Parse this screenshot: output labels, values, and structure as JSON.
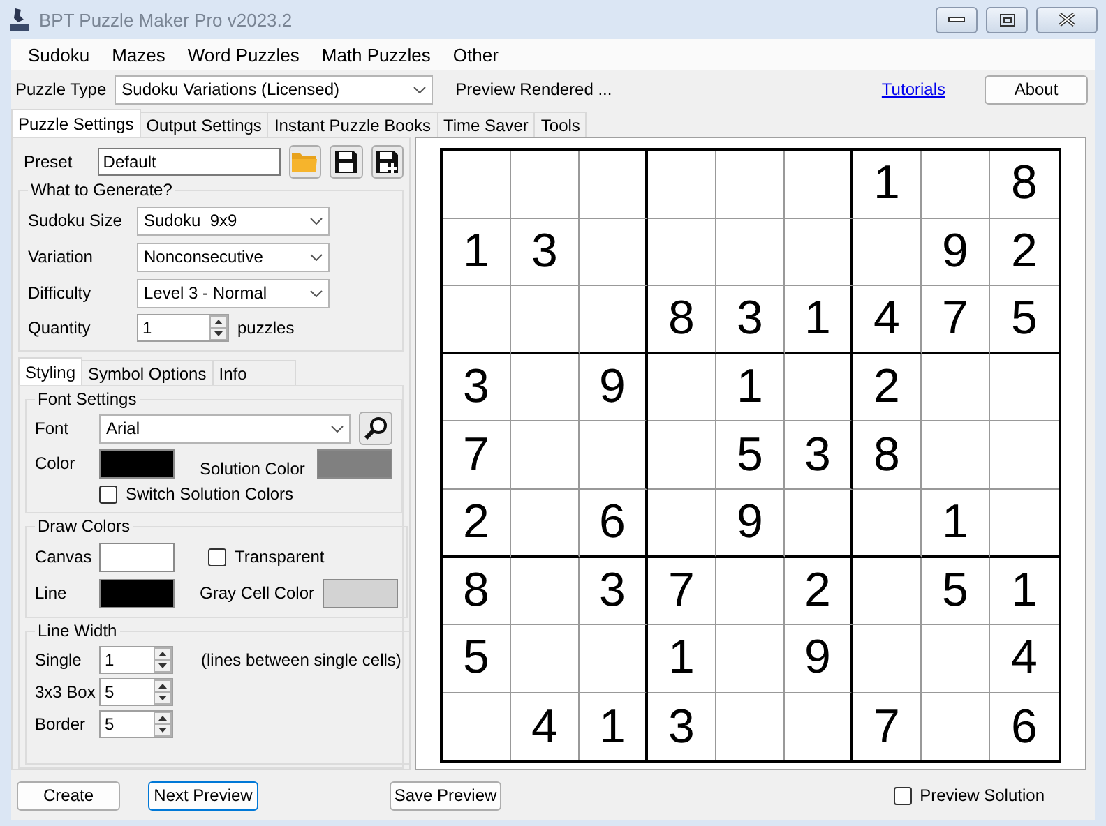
{
  "window": {
    "title": "BPT Puzzle Maker Pro v2023.2"
  },
  "menu": [
    "Sudoku",
    "Mazes",
    "Word Puzzles",
    "Math Puzzles",
    "Other"
  ],
  "toolbar": {
    "puzzle_type_label": "Puzzle Type",
    "puzzle_type": "Sudoku Variations (Licensed)",
    "status": "Preview Rendered ...",
    "tutorials_link": "Tutorials",
    "about_button": "About"
  },
  "tabs": [
    {
      "label": "Puzzle Settings",
      "selected": true
    },
    {
      "label": "Output Settings",
      "selected": false
    },
    {
      "label": "Instant Puzzle Books",
      "selected": false
    },
    {
      "label": "Time Saver",
      "selected": false
    },
    {
      "label": "Tools",
      "selected": false
    }
  ],
  "preset": {
    "label": "Preset",
    "value": "Default"
  },
  "generate": {
    "title": "What to Generate?",
    "fields": [
      {
        "label": "Sudoku Size",
        "value": "Sudoku  9x9"
      },
      {
        "label": "Variation",
        "value": "Nonconsecutive"
      },
      {
        "label": "Difficulty",
        "value": "Level 3 - Normal"
      }
    ],
    "quantity": {
      "label": "Quantity",
      "value": "1",
      "unit": "puzzles"
    }
  },
  "subtabs": [
    {
      "label": "Styling",
      "selected": true
    },
    {
      "label": "Symbol Options",
      "selected": false
    },
    {
      "label": "Info",
      "selected": false
    }
  ],
  "font_settings": {
    "title": "Font Settings",
    "font_label": "Font",
    "font": "Arial",
    "font_color": {
      "label": "Color",
      "color": "#000000"
    },
    "solution_color": {
      "label": "Solution Color",
      "color": "#808080"
    },
    "switch_colors": {
      "label": "Switch Solution Colors",
      "checked": false
    }
  },
  "draw_colors": {
    "title": "Draw Colors",
    "canvas": {
      "label": "Canvas",
      "color": "#ffffff"
    },
    "transparent": {
      "label": "Transparent",
      "checked": false
    },
    "line": {
      "label": "Line",
      "color": "#000000"
    },
    "gray_cell": {
      "label": "Gray Cell Color",
      "color": "#d3d3d3"
    }
  },
  "line_width": {
    "title": "Line Width",
    "rows": [
      {
        "label": "Single",
        "value": "1",
        "note": "(lines between single cells)"
      },
      {
        "label": "3x3 Box",
        "value": "5"
      },
      {
        "label": "Border",
        "value": "5"
      }
    ]
  },
  "grid": [
    [
      {
        "kind": "blank"
      },
      {
        "kind": "blank"
      },
      {
        "kind": "blank"
      },
      {
        "kind": "blank"
      },
      {
        "kind": "blank"
      },
      {
        "kind": "blank"
      },
      {
        "kind": "given",
        "value": "1"
      },
      {
        "kind": "blank"
      },
      {
        "kind": "given",
        "value": "8"
      }
    ],
    [
      {
        "kind": "given",
        "value": "1"
      },
      {
        "kind": "given",
        "value": "3"
      },
      {
        "kind": "blank"
      },
      {
        "kind": "blank"
      },
      {
        "kind": "blank"
      },
      {
        "kind": "blank"
      },
      {
        "kind": "blank"
      },
      {
        "kind": "given",
        "value": "9"
      },
      {
        "kind": "given",
        "value": "2"
      }
    ],
    [
      {
        "kind": "blank"
      },
      {
        "kind": "blank"
      },
      {
        "kind": "blank"
      },
      {
        "kind": "given",
        "value": "8"
      },
      {
        "kind": "given",
        "value": "3"
      },
      {
        "kind": "given",
        "value": "1"
      },
      {
        "kind": "given",
        "value": "4"
      },
      {
        "kind": "given",
        "value": "7"
      },
      {
        "kind": "given",
        "value": "5"
      }
    ],
    [
      {
        "kind": "given",
        "value": "3"
      },
      {
        "kind": "blank"
      },
      {
        "kind": "given",
        "value": "9"
      },
      {
        "kind": "blank"
      },
      {
        "kind": "given",
        "value": "1"
      },
      {
        "kind": "blank"
      },
      {
        "kind": "given",
        "value": "2"
      },
      {
        "kind": "blank"
      },
      {
        "kind": "blank"
      }
    ],
    [
      {
        "kind": "given",
        "value": "7"
      },
      {
        "kind": "blank"
      },
      {
        "kind": "blank"
      },
      {
        "kind": "blank"
      },
      {
        "kind": "given",
        "value": "5"
      },
      {
        "kind": "given",
        "value": "3"
      },
      {
        "kind": "given",
        "value": "8"
      },
      {
        "kind": "blank"
      },
      {
        "kind": "blank"
      }
    ],
    [
      {
        "kind": "given",
        "value": "2"
      },
      {
        "kind": "blank"
      },
      {
        "kind": "given",
        "value": "6"
      },
      {
        "kind": "blank"
      },
      {
        "kind": "given",
        "value": "9"
      },
      {
        "kind": "blank"
      },
      {
        "kind": "blank"
      },
      {
        "kind": "given",
        "value": "1"
      },
      {
        "kind": "blank"
      }
    ],
    [
      {
        "kind": "given",
        "value": "8"
      },
      {
        "kind": "blank"
      },
      {
        "kind": "given",
        "value": "3"
      },
      {
        "kind": "given",
        "value": "7"
      },
      {
        "kind": "blank"
      },
      {
        "kind": "given",
        "value": "2"
      },
      {
        "kind": "blank"
      },
      {
        "kind": "given",
        "value": "5"
      },
      {
        "kind": "given",
        "value": "1"
      }
    ],
    [
      {
        "kind": "given",
        "value": "5"
      },
      {
        "kind": "blank"
      },
      {
        "kind": "blank"
      },
      {
        "kind": "given",
        "value": "1"
      },
      {
        "kind": "blank"
      },
      {
        "kind": "given",
        "value": "9"
      },
      {
        "kind": "blank"
      },
      {
        "kind": "blank"
      },
      {
        "kind": "given",
        "value": "4"
      }
    ],
    [
      {
        "kind": "blank"
      },
      {
        "kind": "given",
        "value": "4"
      },
      {
        "kind": "given",
        "value": "1"
      },
      {
        "kind": "given",
        "value": "3"
      },
      {
        "kind": "blank"
      },
      {
        "kind": "blank"
      },
      {
        "kind": "given",
        "value": "7"
      },
      {
        "kind": "blank"
      },
      {
        "kind": "given",
        "value": "6"
      }
    ]
  ],
  "bottom": {
    "create": "Create",
    "next_preview": "Next Preview",
    "save_preview": "Save Preview",
    "preview_solution": {
      "label": "Preview Solution",
      "checked": false
    }
  }
}
